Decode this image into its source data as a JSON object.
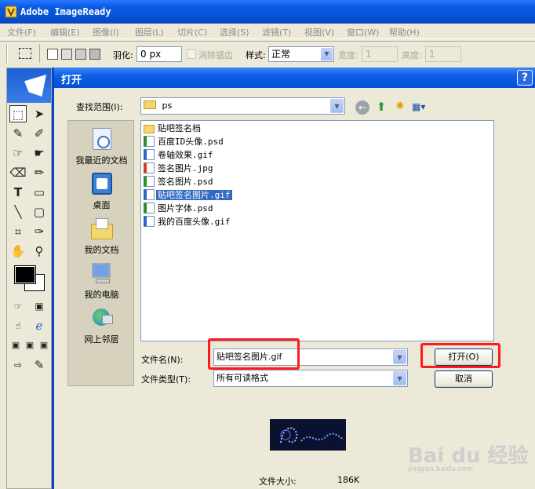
{
  "app": {
    "title": "Adobe ImageReady"
  },
  "menu": [
    "文件(F)",
    "编辑(E)",
    "图像(I)",
    "图层(L)",
    "切片(C)",
    "选择(S)",
    "滤镜(T)",
    "视图(V)",
    "窗口(W)",
    "帮助(H)"
  ],
  "options": {
    "feather_label": "羽化:",
    "feather_value": "0 px",
    "antialias_label": "消除锯齿",
    "style_label": "样式:",
    "style_value": "正常",
    "width_label": "宽度:",
    "width_value": "1",
    "height_label": "高度:",
    "height_value": "1"
  },
  "dialog": {
    "title": "打开",
    "help": "?",
    "look_in_label": "查找范围(I):",
    "look_in_value": "ps",
    "places": [
      "我最近的文档",
      "桌面",
      "我的文档",
      "我的电脑",
      "网上邻居"
    ],
    "files": [
      {
        "name": "贴吧签名档",
        "type": "folder",
        "selected": false
      },
      {
        "name": "百度ID头像.psd",
        "type": "psd",
        "selected": false
      },
      {
        "name": "卷轴效果.gif",
        "type": "gif",
        "selected": false
      },
      {
        "name": "签名图片.jpg",
        "type": "jpg",
        "selected": false
      },
      {
        "name": "签名图片.psd",
        "type": "psd",
        "selected": false
      },
      {
        "name": "贴吧签名图片.gif",
        "type": "gif",
        "selected": true
      },
      {
        "name": "图片字体.psd",
        "type": "psd",
        "selected": false
      },
      {
        "name": "我的百度头像.gif",
        "type": "gif",
        "selected": false
      }
    ],
    "filename_label": "文件名(N):",
    "filename_value": "贴吧签名图片.gif",
    "filetype_label": "文件类型(T):",
    "filetype_value": "所有可读格式",
    "open_button": "打开(O)",
    "cancel_button": "取消",
    "filesize_label": "文件大小:",
    "filesize_value": "186K"
  },
  "watermark": {
    "text": "Bai du 经验",
    "sub": "jingyan.baidu.com"
  },
  "colors": {
    "title_blue": "#0552d4",
    "selection": "#316ac5",
    "highlight_red": "#ff1a1a"
  }
}
